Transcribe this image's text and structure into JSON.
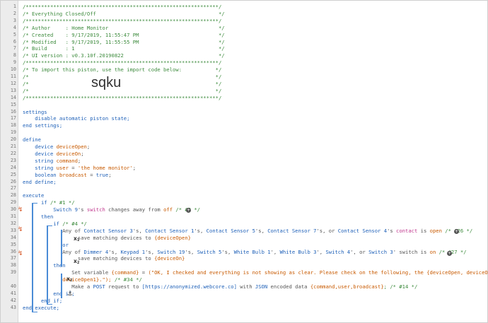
{
  "lines": [
    {
      "n": "1",
      "parts": [
        {
          "t": "/***************************************************************/",
          "c": "cm"
        }
      ]
    },
    {
      "n": "2",
      "parts": [
        {
          "t": "/* Everything Closed/Off                                        */",
          "c": "cm"
        }
      ]
    },
    {
      "n": "3",
      "parts": [
        {
          "t": "/***************************************************************/",
          "c": "cm"
        }
      ]
    },
    {
      "n": "4",
      "parts": [
        {
          "t": "/* Author     : Home Monitor                                    */",
          "c": "cm"
        }
      ]
    },
    {
      "n": "5",
      "parts": [
        {
          "t": "/* Created    : 9/17/2019, 11:55:47 PM                          */",
          "c": "cm"
        }
      ]
    },
    {
      "n": "6",
      "parts": [
        {
          "t": "/* Modified   : 9/17/2019, 11:55:55 PM                          */",
          "c": "cm"
        }
      ]
    },
    {
      "n": "7",
      "parts": [
        {
          "t": "/* Build      : 1                                               */",
          "c": "cm"
        }
      ]
    },
    {
      "n": "8",
      "parts": [
        {
          "t": "/* UI version : v0.3.10f.20190822                               */",
          "c": "cm"
        }
      ]
    },
    {
      "n": "9",
      "parts": [
        {
          "t": "/***************************************************************/",
          "c": "cm"
        }
      ]
    },
    {
      "n": "10",
      "parts": [
        {
          "t": "/* To import this piston, use the import code below:           */",
          "c": "cm"
        }
      ]
    },
    {
      "n": "11",
      "parts": [
        {
          "t": "/*                                                             */",
          "c": "cm"
        }
      ]
    },
    {
      "n": "12",
      "parts": [
        {
          "t": "/*                                                             */",
          "c": "cm"
        }
      ]
    },
    {
      "n": "13",
      "parts": [
        {
          "t": "/*                                                             */",
          "c": "cm"
        }
      ]
    },
    {
      "n": "14",
      "parts": [
        {
          "t": "/***************************************************************/",
          "c": "cm"
        }
      ]
    },
    {
      "n": "15",
      "parts": []
    },
    {
      "n": "16",
      "parts": [
        {
          "t": "settings",
          "c": "kw"
        }
      ]
    },
    {
      "n": "17",
      "parts": [
        {
          "t": "    disable automatic piston state;",
          "c": "kw"
        }
      ]
    },
    {
      "n": "18",
      "parts": [
        {
          "t": "end settings;",
          "c": "kw"
        }
      ]
    },
    {
      "n": "19",
      "parts": []
    },
    {
      "n": "20",
      "parts": [
        {
          "t": "define",
          "c": "kw"
        }
      ]
    },
    {
      "n": "21",
      "parts": [
        {
          "t": "    device ",
          "c": "kw"
        },
        {
          "t": "deviceOpen",
          "c": "var"
        },
        {
          "t": ";",
          "c": "op"
        }
      ]
    },
    {
      "n": "22",
      "parts": [
        {
          "t": "    device ",
          "c": "kw"
        },
        {
          "t": "deviceOn",
          "c": "var"
        },
        {
          "t": ";",
          "c": "op"
        }
      ]
    },
    {
      "n": "23",
      "parts": [
        {
          "t": "    string ",
          "c": "kw"
        },
        {
          "t": "command",
          "c": "var"
        },
        {
          "t": ";",
          "c": "op"
        }
      ]
    },
    {
      "n": "24",
      "parts": [
        {
          "t": "    string ",
          "c": "kw"
        },
        {
          "t": "user",
          "c": "var"
        },
        {
          "t": " = ",
          "c": "op"
        },
        {
          "t": "'the home monitor'",
          "c": "str"
        },
        {
          "t": ";",
          "c": "op"
        }
      ]
    },
    {
      "n": "25",
      "parts": [
        {
          "t": "    boolean ",
          "c": "kw"
        },
        {
          "t": "broadcast",
          "c": "var"
        },
        {
          "t": " = ",
          "c": "op"
        },
        {
          "t": "true",
          "c": "kw"
        },
        {
          "t": ";",
          "c": "op"
        }
      ]
    },
    {
      "n": "26",
      "parts": [
        {
          "t": "end define;",
          "c": "kw"
        }
      ]
    },
    {
      "n": "27",
      "parts": []
    },
    {
      "n": "28",
      "parts": [
        {
          "t": "execute",
          "c": "kw"
        }
      ]
    },
    {
      "n": "29",
      "parts": [
        {
          "t": "      if ",
          "c": "kw"
        },
        {
          "t": "/* #1 */",
          "c": "cm"
        }
      ]
    },
    {
      "n": "30",
      "parts": [
        {
          "t": "          ",
          "c": "op"
        },
        {
          "t": "Switch 9",
          "c": "dev"
        },
        {
          "t": "'s ",
          "c": "op"
        },
        {
          "t": "switch",
          "c": "pink"
        },
        {
          "t": " changes away from ",
          "c": "op"
        },
        {
          "t": "off",
          "c": "str"
        },
        {
          "t": " /* #3 */",
          "c": "cm"
        }
      ]
    },
    {
      "n": "31",
      "parts": [
        {
          "t": "      then",
          "c": "kw"
        }
      ]
    },
    {
      "n": "32",
      "parts": [
        {
          "t": "          if ",
          "c": "kw"
        },
        {
          "t": "/* #4 */",
          "c": "cm"
        }
      ]
    },
    {
      "n": "33",
      "parts": [
        {
          "t": "             Any of ",
          "c": "op"
        },
        {
          "t": "Contact Sensor 3",
          "c": "dev"
        },
        {
          "t": "'s, ",
          "c": "op"
        },
        {
          "t": "Contact Sensor 1",
          "c": "dev"
        },
        {
          "t": "'s, ",
          "c": "op"
        },
        {
          "t": "Contact Sensor 5",
          "c": "dev"
        },
        {
          "t": "'s, ",
          "c": "op"
        },
        {
          "t": "Contact Sensor 7",
          "c": "dev"
        },
        {
          "t": "'s, or ",
          "c": "op"
        },
        {
          "t": "Contact Sensor 4",
          "c": "dev"
        },
        {
          "t": "'s ",
          "c": "op"
        },
        {
          "t": "contact",
          "c": "pink"
        },
        {
          "t": " is ",
          "c": "op"
        },
        {
          "t": "open",
          "c": "str"
        },
        {
          "t": " /* #26 */",
          "c": "cm"
        }
      ]
    },
    {
      "n": "34",
      "parts": [
        {
          "t": "                  save matching devices to ",
          "c": "op"
        },
        {
          "t": "{deviceOpen}",
          "c": "str"
        }
      ]
    },
    {
      "n": "35",
      "parts": [
        {
          "t": "             or",
          "c": "kw"
        }
      ]
    },
    {
      "n": "36",
      "parts": [
        {
          "t": "             Any of ",
          "c": "op"
        },
        {
          "t": "Dimmer 4",
          "c": "dev"
        },
        {
          "t": "'s, ",
          "c": "op"
        },
        {
          "t": "Keypad 1",
          "c": "dev"
        },
        {
          "t": "'s, ",
          "c": "op"
        },
        {
          "t": "Switch 19",
          "c": "dev"
        },
        {
          "t": "'s, ",
          "c": "op"
        },
        {
          "t": "Switch 5",
          "c": "dev"
        },
        {
          "t": "'s, ",
          "c": "op"
        },
        {
          "t": "White Bulb 1",
          "c": "dev"
        },
        {
          "t": "', ",
          "c": "op"
        },
        {
          "t": "White Bulb 3",
          "c": "dev"
        },
        {
          "t": "', ",
          "c": "op"
        },
        {
          "t": "Switch 4",
          "c": "dev"
        },
        {
          "t": "', or ",
          "c": "op"
        },
        {
          "t": "Switch 3",
          "c": "dev"
        },
        {
          "t": "' switch is ",
          "c": "op"
        },
        {
          "t": "on",
          "c": "str"
        },
        {
          "t": " /* #27 */",
          "c": "cm"
        }
      ]
    },
    {
      "n": "37",
      "parts": [
        {
          "t": "                  save matching devices to ",
          "c": "op"
        },
        {
          "t": "{deviceOn}",
          "c": "str"
        }
      ]
    },
    {
      "n": "38",
      "parts": [
        {
          "t": "          then",
          "c": "kw"
        }
      ]
    },
    {
      "n": "39",
      "parts": [
        {
          "t": "                Set variable ",
          "c": "op"
        },
        {
          "t": "{command}",
          "c": "str"
        },
        {
          "t": " = ",
          "c": "op"
        },
        {
          "t": "(\"OK, I checked and everything is not showing as clear. Please check on the following, the {deviceOpen, deviceOn,",
          "c": "str"
        }
      ]
    },
    {
      "n": "",
      "parts": [
        {
          "t": "             deviceOpen1}.\");",
          "c": "str"
        },
        {
          "t": " /* #34 */",
          "c": "cm"
        }
      ]
    },
    {
      "n": "40",
      "parts": [
        {
          "t": "                Make a ",
          "c": "op"
        },
        {
          "t": "POST",
          "c": "kw"
        },
        {
          "t": " request to ",
          "c": "op"
        },
        {
          "t": "[https://anonymized.webcore.co]",
          "c": "kw"
        },
        {
          "t": " with ",
          "c": "op"
        },
        {
          "t": "JSON",
          "c": "kw"
        },
        {
          "t": " encoded data ",
          "c": "op"
        },
        {
          "t": "{command,user,broadcast}",
          "c": "str"
        },
        {
          "t": "; /* #14 */",
          "c": "cm"
        }
      ]
    },
    {
      "n": "41",
      "parts": [
        {
          "t": "          end if;",
          "c": "kw"
        }
      ]
    },
    {
      "n": "42",
      "parts": [
        {
          "t": "      end if;",
          "c": "kw"
        }
      ]
    },
    {
      "n": "43",
      "parts": [
        {
          "t": "end execute;",
          "c": "kw"
        }
      ]
    }
  ],
  "import_code": "sqku",
  "var_markers": {
    "x1": "x",
    "x1_sub": "1",
    "x2": "x",
    "x2_sub": "2",
    "x3": "x",
    "x3_sub": "2",
    "add": "+"
  }
}
